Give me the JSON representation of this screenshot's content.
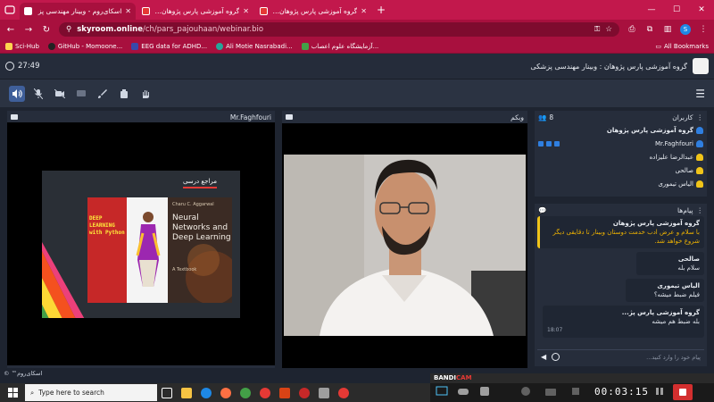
{
  "browser": {
    "tabs": [
      {
        "title": "اسکای‌روم - وبینار مهندسی پز",
        "active": true
      },
      {
        "title": "گروه آموزشی پارس پژوهان ارائه",
        "active": false
      },
      {
        "title": "گروه آموزشی پارس پژوهان ارائه",
        "active": false
      }
    ],
    "url_domain": "skyroom.online",
    "url_path": "/ch/pars_pajouhaan/webinar.bio",
    "profile_initial": "S",
    "bookmarks": [
      "Sci-Hub",
      "GitHub - Momoone...",
      "EEG data for ADHD...",
      "Ali Motie Nasrabadi...",
      "آزمایشگاه علوم اعصاب..."
    ],
    "all_bookmarks_label": "All Bookmarks"
  },
  "app": {
    "clock": "27:49",
    "room_title": "گروه آموزشی پارس پژوهان : وبینار مهندسی پزشکی"
  },
  "screen_share": {
    "owner": "Mr.Faghfouri",
    "slide_title": "مراجع درسی",
    "book1_title_line1": "DEEP LEARNING",
    "book1_title_line2": "with Python",
    "book2_author": "Charu C. Aggarwal",
    "book2_title": "Neural Networks and Deep Learning",
    "book2_subtitle": "A Textbook"
  },
  "webcam": {
    "label": "وبکم"
  },
  "users": {
    "label": "کاربران",
    "count": "8",
    "list": [
      {
        "name": "گروه آموزشی پارس پژوهان",
        "role": "host"
      },
      {
        "name": "Mr.Faghfouri",
        "role": "presenter"
      },
      {
        "name": "عبدالرضا علیزاده",
        "role": "guest"
      },
      {
        "name": "صالحی",
        "role": "guest"
      },
      {
        "name": "الیاس تیموری",
        "role": "guest"
      }
    ]
  },
  "chat": {
    "label": "پیام‌ها",
    "messages": [
      {
        "who": "گروه آموزشی پارس پژوهان",
        "text": "با سلام و عرض ادب خدمت دوستان وبینار تا دقایقی دیگر شروع خواهد شد."
      },
      {
        "who": "صالحی",
        "text": "سلام بله"
      },
      {
        "who": "الیاس تیموری",
        "text": "فیلم ضبط میشه؟"
      },
      {
        "who": "گروه آموزشی پارس پژ...",
        "text": "بله ضبط هم میشه",
        "time": "18:07"
      }
    ],
    "placeholder": "پیام خود را وارد کنید..."
  },
  "footer": "اسکای‌روم™ ©",
  "taskbar": {
    "search_placeholder": "Type here to search"
  },
  "bandicam": {
    "brand_a": "BANDI",
    "brand_b": "CAM",
    "timer": "00:03:15"
  },
  "colors": {
    "chrome": "#a8103e",
    "app_bg": "#1e2430",
    "panel": "#262d3b",
    "accent_blue": "#2f7fe0",
    "guest_yellow": "#f0c419"
  }
}
